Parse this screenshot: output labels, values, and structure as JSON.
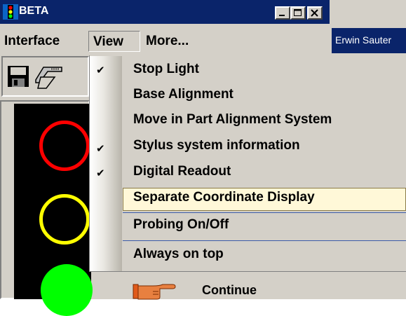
{
  "window": {
    "title": "BETA"
  },
  "menubar": {
    "items": [
      "Interface",
      "View",
      "More..."
    ]
  },
  "background_window": {
    "label": "Erwin Sauter"
  },
  "dropdown": {
    "items": [
      {
        "label": "Stop Light",
        "checked": true
      },
      {
        "label": "Base Alignment",
        "checked": false
      },
      {
        "label": "Move in Part Alignment System",
        "checked": false
      },
      {
        "label": "Stylus system information",
        "checked": true
      },
      {
        "label": "Digital Readout",
        "checked": true
      },
      {
        "label": "Separate Coordinate Display",
        "checked": false,
        "highlighted": true
      },
      {
        "label": "Probing On/Off",
        "checked": false
      },
      {
        "label": "Always on top",
        "checked": false
      }
    ]
  },
  "below_menu": {
    "continue_label": "Continue"
  },
  "stop_light": {
    "red": "#ff0000",
    "yellow": "#ffff00",
    "green": "#00ff00"
  },
  "colors": {
    "titlebar": "#0a246a",
    "highlight": "#fff8d8"
  }
}
